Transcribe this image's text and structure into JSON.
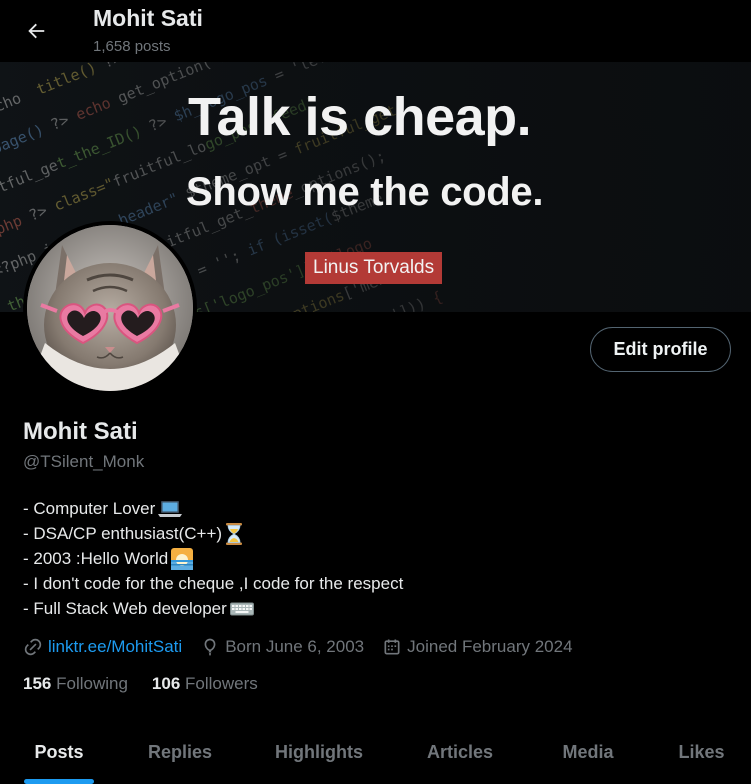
{
  "header": {
    "name": "Mohit Sati",
    "posts": "1,658 posts"
  },
  "banner": {
    "line1": "Talk is cheap.",
    "line2": "Show me the code.",
    "author": "Linus Torvalds"
  },
  "profile": {
    "display_name": "Mohit Sati",
    "handle": "@TSilent_Monk",
    "edit_label": "Edit profile",
    "bio": [
      {
        "text": "- Computer Lover",
        "emoji": "laptop-icon"
      },
      {
        "text": "- DSA/CP enthusiast(C++)",
        "emoji": "hourglass-icon"
      },
      {
        "text": "- 2003 :Hello World",
        "emoji": "sunrise-icon"
      },
      {
        "text": "- I don't code for the cheque ,I code for the respect",
        "emoji": ""
      },
      {
        "text": "- Full Stack Web developer",
        "emoji": "keyboard-icon"
      }
    ],
    "link": "linktr.ee/MohitSati",
    "born": "Born June 6, 2003",
    "joined": "Joined February 2024",
    "following_count": "156",
    "following_label": "Following",
    "followers_count": "106",
    "followers_label": "Followers"
  },
  "tabs": [
    "Posts",
    "Replies",
    "Highlights",
    "Articles",
    "Media",
    "Likes"
  ],
  "active_tab": "Posts",
  "colors": {
    "accent": "#1d9bf0",
    "muted": "#71767b",
    "text": "#e7e9ea",
    "background": "#000000",
    "quote_tag": "#b33a36"
  }
}
